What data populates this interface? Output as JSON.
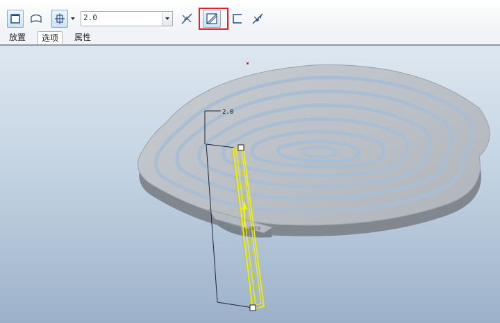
{
  "toolbar": {
    "depth_value": "2.0",
    "icons": {
      "solid": "solid-extrude-icon",
      "surface": "surface-extrude-icon",
      "depth_type": "blind-depth-icon",
      "flip": "flip-direction-icon",
      "thicken": "thicken-sketch-icon",
      "remove": "remove-material-icon",
      "flip_thickness": "flip-thickness-icon"
    },
    "highlight_color": "#e0242b"
  },
  "tabs": [
    {
      "label": "放置"
    },
    {
      "label": "选项"
    },
    {
      "label": "属性"
    }
  ],
  "active_tab": "选项",
  "viewport": {
    "dimension_value": "2.0",
    "axis_label": "TNTO",
    "preview_color": "#f3f300"
  }
}
